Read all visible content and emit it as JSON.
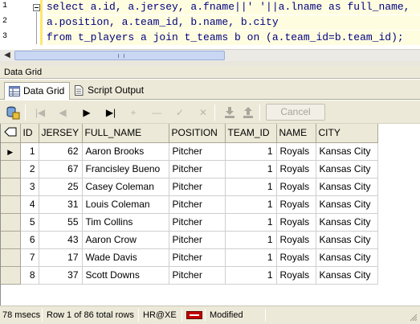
{
  "editor": {
    "line_numbers": [
      "1",
      "2",
      "3"
    ],
    "lines": [
      "select a.id, a.jersey, a.fname||' '||a.lname as full_name,",
      "a.position, a.team_id, b.name, b.city",
      "from t_players a join t_teams b on (a.team_id=b.team_id);"
    ]
  },
  "panel": {
    "title": "Data Grid"
  },
  "tabs": [
    {
      "label": "Data Grid",
      "icon": "grid-icon"
    },
    {
      "label": "Script Output",
      "icon": "document-icon"
    }
  ],
  "toolbar": {
    "cancel_label": "Cancel"
  },
  "grid": {
    "columns": [
      "ID",
      "JERSEY",
      "FULL_NAME",
      "POSITION",
      "TEAM_ID",
      "NAME",
      "CITY"
    ],
    "rows": [
      [
        "1",
        "62",
        "Aaron Brooks",
        "Pitcher",
        "1",
        "Royals",
        "Kansas City"
      ],
      [
        "2",
        "67",
        "Francisley Bueno",
        "Pitcher",
        "1",
        "Royals",
        "Kansas City"
      ],
      [
        "3",
        "25",
        "Casey Coleman",
        "Pitcher",
        "1",
        "Royals",
        "Kansas City"
      ],
      [
        "4",
        "31",
        "Louis Coleman",
        "Pitcher",
        "1",
        "Royals",
        "Kansas City"
      ],
      [
        "5",
        "55",
        "Tim Collins",
        "Pitcher",
        "1",
        "Royals",
        "Kansas City"
      ],
      [
        "6",
        "43",
        "Aaron Crow",
        "Pitcher",
        "1",
        "Royals",
        "Kansas City"
      ],
      [
        "7",
        "17",
        "Wade Davis",
        "Pitcher",
        "1",
        "Royals",
        "Kansas City"
      ],
      [
        "8",
        "37",
        "Scott Downs",
        "Pitcher",
        "1",
        "Royals",
        "Kansas City"
      ]
    ],
    "selected_row": 0
  },
  "status": {
    "elapsed": "78 msecs",
    "row_info": "Row 1 of 86 total rows",
    "connection": "HR@XE",
    "state": "Modified"
  }
}
